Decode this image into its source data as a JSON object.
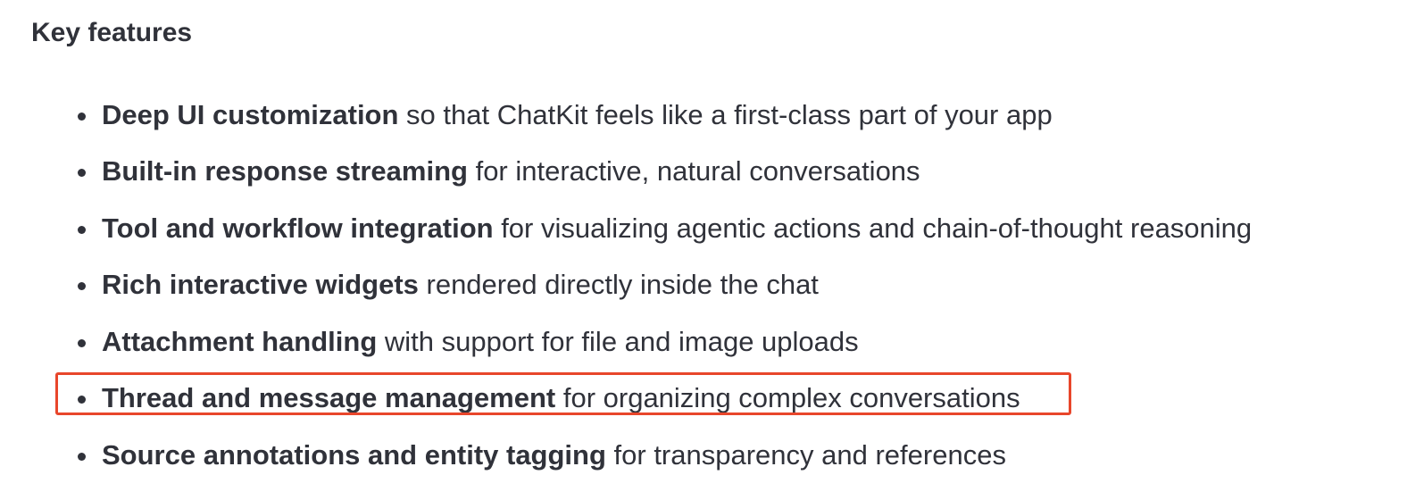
{
  "heading": "Key features",
  "features": [
    {
      "bold": "Deep UI customization",
      "rest": " so that ChatKit feels like a first-class part of your app"
    },
    {
      "bold": "Built-in response streaming",
      "rest": " for interactive, natural conversations"
    },
    {
      "bold": "Tool and workflow integration",
      "rest": " for visualizing agentic actions and chain-of-thought reasoning"
    },
    {
      "bold": "Rich interactive widgets",
      "rest": " rendered directly inside the chat"
    },
    {
      "bold": "Attachment handling",
      "rest": " with support for file and image uploads"
    },
    {
      "bold": "Thread and message management",
      "rest": " for organizing complex conversations"
    },
    {
      "bold": "Source annotations and entity tagging",
      "rest": " for transparency and references"
    }
  ],
  "highlight": {
    "color": "#e8462b",
    "target_feature_index": 5
  },
  "colors": {
    "text": "#30323a",
    "background": "#ffffff"
  }
}
